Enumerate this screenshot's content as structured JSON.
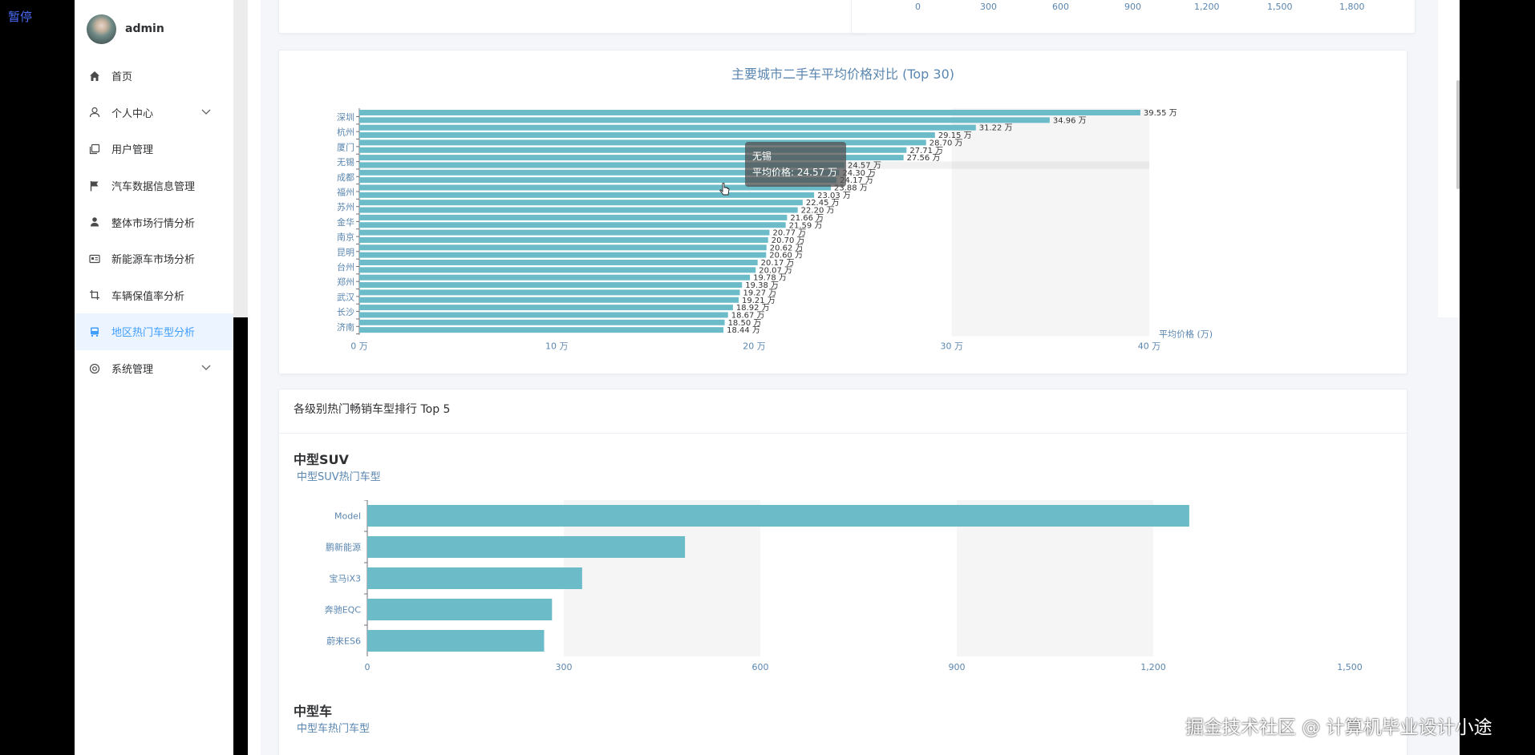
{
  "overlay": {
    "pause_label": "暂停"
  },
  "user": {
    "name": "admin"
  },
  "sidebar": {
    "items": [
      {
        "label": "首页",
        "icon": "home-icon"
      },
      {
        "label": "个人中心",
        "icon": "user-icon",
        "expandable": true
      },
      {
        "label": "用户管理",
        "icon": "copy-icon"
      },
      {
        "label": "汽车数据信息管理",
        "icon": "flag-icon"
      },
      {
        "label": "整体市场行情分析",
        "icon": "person-icon"
      },
      {
        "label": "新能源车市场分析",
        "icon": "id-card-icon"
      },
      {
        "label": "车辆保值率分析",
        "icon": "crop-icon"
      },
      {
        "label": "地区热门车型分析",
        "icon": "bus-icon",
        "active": true
      },
      {
        "label": "系统管理",
        "icon": "settings-icon",
        "expandable": true
      }
    ]
  },
  "top_partial_axis": {
    "ticks": [
      "0",
      "300",
      "600",
      "900",
      "1,200",
      "1,500",
      "1,800"
    ]
  },
  "chart_city": {
    "title": "主要城市二手车平均价格对比 (Top 30)",
    "x_axis_name": "平均价格 (万)",
    "x_ticks": [
      "0 万",
      "10 万",
      "20 万",
      "30 万",
      "40 万"
    ],
    "y_labels_shown": [
      "深圳",
      "杭州",
      "厦门",
      "无锡",
      "成都",
      "福州",
      "苏州",
      "金华",
      "南京",
      "昆明",
      "台州",
      "郑州",
      "武汉",
      "长沙",
      "济南"
    ],
    "value_labels": [
      "39.55 万",
      "34.96 万",
      "31.22 万",
      "29.15 万",
      "28.70 万",
      "27.71 万",
      "27.56 万",
      "24.57 万",
      "24.30 万",
      "24.17 万",
      "23.88 万",
      "23.03 万",
      "22.45 万",
      "22.20 万",
      "21.66 万",
      "21.59 万",
      "20.77 万",
      "20.70 万",
      "20.62 万",
      "20.60 万",
      "20.17 万",
      "20.07 万",
      "19.78 万",
      "19.38 万",
      "19.27 万",
      "19.21 万",
      "18.92 万",
      "18.67 万",
      "18.50 万",
      "18.44 万"
    ],
    "tooltip": {
      "city": "无锡",
      "text": "平均价格: 24.57 万"
    }
  },
  "chart_data": [
    {
      "type": "bar",
      "title": "主要城市二手车平均价格对比 (Top 30)",
      "xlabel": "平均价格 (万)",
      "xlim": [
        0,
        40
      ],
      "categories": [
        "深圳",
        "",
        "杭州",
        "",
        "厦门",
        "",
        "无锡",
        "",
        "成都",
        "",
        "福州",
        "",
        "苏州",
        "",
        "金华",
        "",
        "南京",
        "",
        "昆明",
        "",
        "台州",
        "",
        "郑州",
        "",
        "武汉",
        "",
        "长沙",
        "",
        "济南",
        ""
      ],
      "values": [
        39.55,
        34.96,
        31.22,
        29.15,
        28.7,
        27.71,
        27.56,
        24.57,
        24.3,
        24.17,
        23.88,
        23.03,
        22.45,
        22.2,
        21.66,
        21.59,
        20.77,
        20.7,
        20.62,
        20.6,
        20.17,
        20.07,
        19.78,
        19.38,
        19.27,
        19.21,
        18.92,
        18.67,
        18.5,
        18.44
      ]
    },
    {
      "type": "bar",
      "title": "中型SUV热门车型",
      "categories": [
        "Model",
        "鹏新能源",
        "宝马iX3",
        "奔驰EQC",
        "蔚来ES6"
      ],
      "values": [
        1255,
        485,
        328,
        282,
        270
      ],
      "xlim": [
        0,
        1500
      ],
      "x_ticks": [
        "0",
        "300",
        "600",
        "900",
        "1,200",
        "1,500"
      ]
    }
  ],
  "section_card": {
    "header": "各级别热门畅销车型排行 Top 5",
    "sections": [
      {
        "title": "中型SUV",
        "subtitle": "中型SUV热门车型"
      },
      {
        "title": "中型车",
        "subtitle": "中型车热门车型"
      }
    ]
  },
  "watermark": "掘金技术社区 @ 计算机毕业设计小途",
  "colors": {
    "bar": "#6bbcc8",
    "accent": "#409eff",
    "axis_text": "#5a86b0"
  }
}
